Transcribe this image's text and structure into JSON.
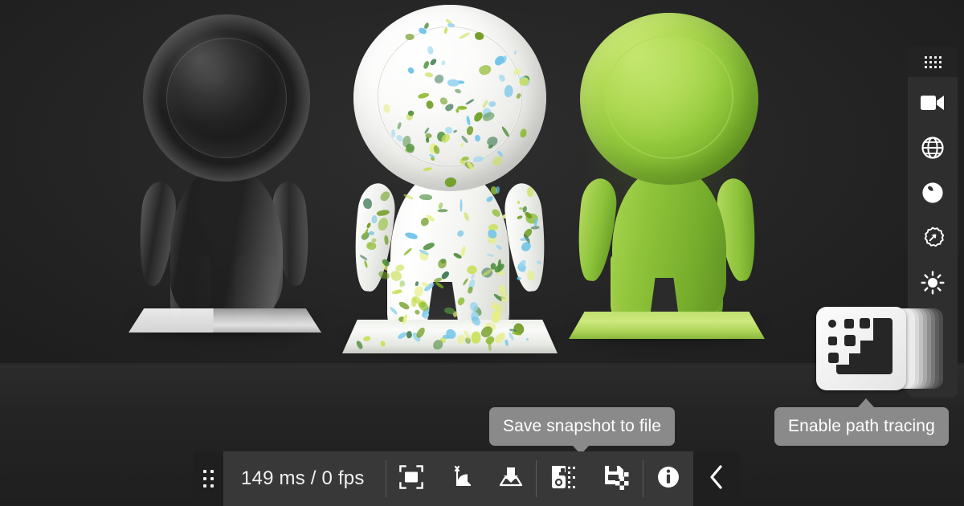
{
  "app": {
    "title": "3D model viewer",
    "background_color": "#262626"
  },
  "viewport": {
    "models": [
      {
        "name": "clear-glass-figure",
        "material": "transparent glass",
        "color": "#2a2a2a"
      },
      {
        "name": "speckled-white-figure",
        "material": "speckled white plastic",
        "color": "#f5f6f2"
      },
      {
        "name": "green-translucent-figure",
        "material": "translucent green resin",
        "color": "#8ec23a"
      }
    ]
  },
  "bottom_toolbar": {
    "drag_handle": "drag-handle",
    "stats": "149 ms / 0 fps",
    "buttons": [
      {
        "name": "fit-to-view-button",
        "icon": "fit-frame-icon",
        "label": "Fit to view"
      },
      {
        "name": "axis-gizmo-button",
        "icon": "axis-angle-icon",
        "label": "Axis gizmo"
      },
      {
        "name": "ground-plane-button",
        "icon": "ground-drop-icon",
        "label": "Ground plane"
      },
      {
        "name": "copy-snapshot-button",
        "icon": "camera-copy-icon",
        "label": "Copy snapshot to clipboard"
      },
      {
        "name": "save-snapshot-button",
        "icon": "save-snapshot-icon",
        "label": "Save snapshot to file"
      },
      {
        "name": "info-button",
        "icon": "info-icon",
        "label": "Information"
      }
    ],
    "collapse": {
      "name": "collapse-toolbar-button",
      "icon": "chevron-left-icon",
      "glyph": "‹"
    }
  },
  "right_toolbar": {
    "drag_handle": "drag-handle",
    "items": [
      {
        "name": "camera-button",
        "icon": "video-camera-icon",
        "label": "Camera"
      },
      {
        "name": "environment-button",
        "icon": "globe-icon",
        "label": "Environment"
      },
      {
        "name": "material-button",
        "icon": "material-sphere-icon",
        "label": "Material"
      },
      {
        "name": "render-settings-button",
        "icon": "flower-gear-icon",
        "label": "Render settings"
      },
      {
        "name": "lighting-button",
        "icon": "sun-icon",
        "label": "Lighting"
      }
    ]
  },
  "path_tracing": {
    "button_name": "enable-path-tracing-button",
    "icon": "path-tracing-stack-icon"
  },
  "tooltips": {
    "snapshot": "Save snapshot to file",
    "path_tracing": "Enable path tracing"
  }
}
